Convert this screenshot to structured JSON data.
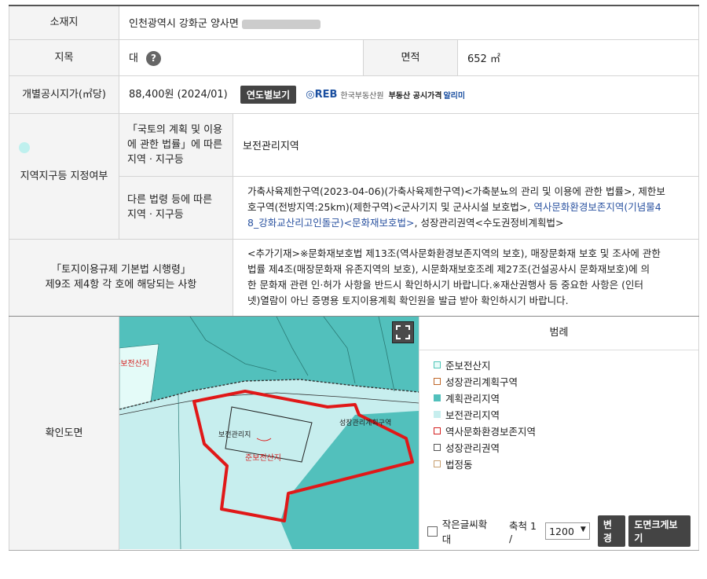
{
  "location": {
    "label": "소재지",
    "value": "인천광역시 강화군 양사면"
  },
  "land_category": {
    "label": "지목",
    "value": "대",
    "help_icon": "?"
  },
  "area": {
    "label": "면적",
    "value": "652 ㎡"
  },
  "price": {
    "label": "개별공시지가(㎡당)",
    "value": "88,400원 (2024/01)",
    "button": "연도별보기",
    "reb_logo": "REB",
    "reb_org": "한국부동산원",
    "reb_service": "부동산 공시가격",
    "reb_app": "알리미"
  },
  "zoning": {
    "label": "지역지구등 지정여부",
    "national_law_label_1": "「국토의 계획 및 이용",
    "national_law_label_2": "에 관한 법률」에 따른",
    "national_law_label_3": "지역ㆍ지구등",
    "national_law_value": "보전관리지역",
    "other_law_label_1": "다른 법령 등에 따른",
    "other_law_label_2": "지역ㆍ지구등",
    "other_law_line_1": "가축사육제한구역(2023-04-06)(가축사육제한구역)<가축분뇨의 관리 및 이용에 관한 법률>, 제한보",
    "other_law_line_2": "호구역(전방지역:25km)(제한구역)<군사기지 및 군사시설 보호법>,",
    "other_law_link_1": "역사문화환경보존지역(기념물4",
    "other_law_link_2": "8_강화교산리고인돌군)<문화재보호법>",
    "other_law_line_3": ", 성장관리권역<수도권정비계획법>"
  },
  "regulation": {
    "label_1": "「토지이용규제 기본법 시행령」",
    "label_2": "제9조 제4항 각 호에 해당되는 사항",
    "lines": [
      "<추가기재>※문화재보호법 제13조(역사문화환경보존지역의 보호), 매장문화재 보호 및 조사에 관한",
      "법률 제4조(매장문화재 유존지역의 보호), 시문화재보호조례 제27조(건설공사시 문화재보호)에 의",
      "한 문화재 관련 인·허가 사항을 반드시 확인하시기 바랍니다.※재산권행사 등 중요한 사항은 (인터",
      "넷)열람이 아닌 증명용 토지이용계획 확인원을 발급 받아 확인하시기 바랍니다."
    ]
  },
  "map_section": {
    "label": "확인도면",
    "map_labels": {
      "zone_left": "준보전산지",
      "parcel_a": "보전관리지",
      "parcel_b": "준보전산지",
      "growth": "성장관리계획구역"
    },
    "legend_title": "범례",
    "legend": [
      {
        "label": "준보전산지",
        "fill": "#e8fbf8",
        "border": "#4fc6b8"
      },
      {
        "label": "성장관리계획구역",
        "fill": "#ffffff",
        "border": "#c0682a"
      },
      {
        "label": "계획관리지역",
        "fill": "#52c0bc",
        "border": "#52c0bc"
      },
      {
        "label": "보전관리지역",
        "fill": "#c7eeee",
        "border": "#c7eeee"
      },
      {
        "label": "역사문화환경보존지역",
        "fill": "#ffffff",
        "border": "#d42020"
      },
      {
        "label": "성장관리권역",
        "fill": "#ffffff",
        "border": "#555555"
      },
      {
        "label": "법정동",
        "fill": "#ffffff",
        "border": "#c8a070"
      }
    ],
    "small_font_label": "작은글씨확대",
    "scale_label": "축척 1 /",
    "scale_value": "1200",
    "change_button": "변경",
    "enlarge_button": "도면크게보기"
  }
}
